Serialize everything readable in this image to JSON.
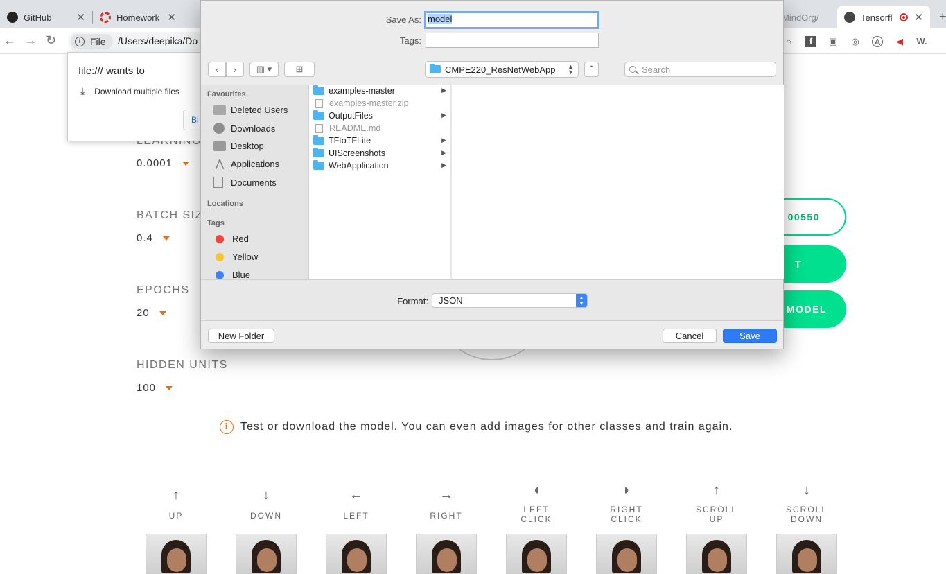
{
  "browser": {
    "tabs": [
      {
        "title": "GitHub",
        "icon": "github-icon"
      },
      {
        "title": "Homework",
        "icon": "homework-icon"
      },
      {
        "title": "MindOrg/",
        "icon": "page-icon"
      },
      {
        "title": "Tensorfl",
        "icon": "globe-icon",
        "recording": true
      }
    ],
    "address": {
      "chip": "File",
      "url": "/Users/deepika/Do"
    }
  },
  "permission": {
    "title": "file:/// wants to",
    "item": "Download multiple files",
    "block_label": "Bl"
  },
  "page": {
    "params": [
      {
        "label": "LEARNING",
        "value": "0.0001"
      },
      {
        "label": "BATCH SIZ",
        "value": "0.4"
      },
      {
        "label": "EPOCHS",
        "value": "20"
      },
      {
        "label": "HIDDEN UNITS",
        "value": "100"
      }
    ],
    "buttons": {
      "loss": "00550",
      "train": "T",
      "download": "MODEL"
    },
    "info": "Test or download the model. You can even add images for other classes and train again.",
    "controls": [
      {
        "glyph": "↑",
        "label": "UP"
      },
      {
        "glyph": "↓",
        "label": "DOWN"
      },
      {
        "glyph": "←",
        "label": "LEFT"
      },
      {
        "glyph": "→",
        "label": "RIGHT"
      },
      {
        "glyph": "◖",
        "label": "LEFT\nCLICK"
      },
      {
        "glyph": "◗",
        "label": "RIGHT\nCLICK"
      },
      {
        "glyph": "↑",
        "label": "SCROLL\nUP"
      },
      {
        "glyph": "↓",
        "label": "SCROLL\nDOWN"
      }
    ]
  },
  "dialog": {
    "save_as_label": "Save As:",
    "save_as_value": "model",
    "tags_label": "Tags:",
    "location": "CMPE220_ResNetWebApp",
    "search_placeholder": "Search",
    "sidebar": {
      "favourites_header": "Favourites",
      "favourites": [
        "Deleted Users",
        "Downloads",
        "Desktop",
        "Applications",
        "Documents"
      ],
      "locations_header": "Locations",
      "tags_header": "Tags",
      "tags": [
        {
          "name": "Red",
          "color": "#f0443a"
        },
        {
          "name": "Yellow",
          "color": "#f6c531"
        },
        {
          "name": "Blue",
          "color": "#3a82f7"
        }
      ]
    },
    "files": [
      {
        "name": "examples-master",
        "type": "folder"
      },
      {
        "name": "examples-master.zip",
        "type": "file"
      },
      {
        "name": "OutputFiles",
        "type": "folder"
      },
      {
        "name": "README.md",
        "type": "file"
      },
      {
        "name": "TFtoTFLite",
        "type": "folder"
      },
      {
        "name": "UIScreenshots",
        "type": "folder"
      },
      {
        "name": "WebApplication",
        "type": "folder"
      }
    ],
    "format_label": "Format:",
    "format_value": "JSON",
    "new_folder": "New Folder",
    "cancel": "Cancel",
    "save": "Save"
  },
  "colors": {
    "accent_green": "#00e08f",
    "accent_orange": "#e8710a",
    "mac_blue": "#2f7bf5"
  }
}
